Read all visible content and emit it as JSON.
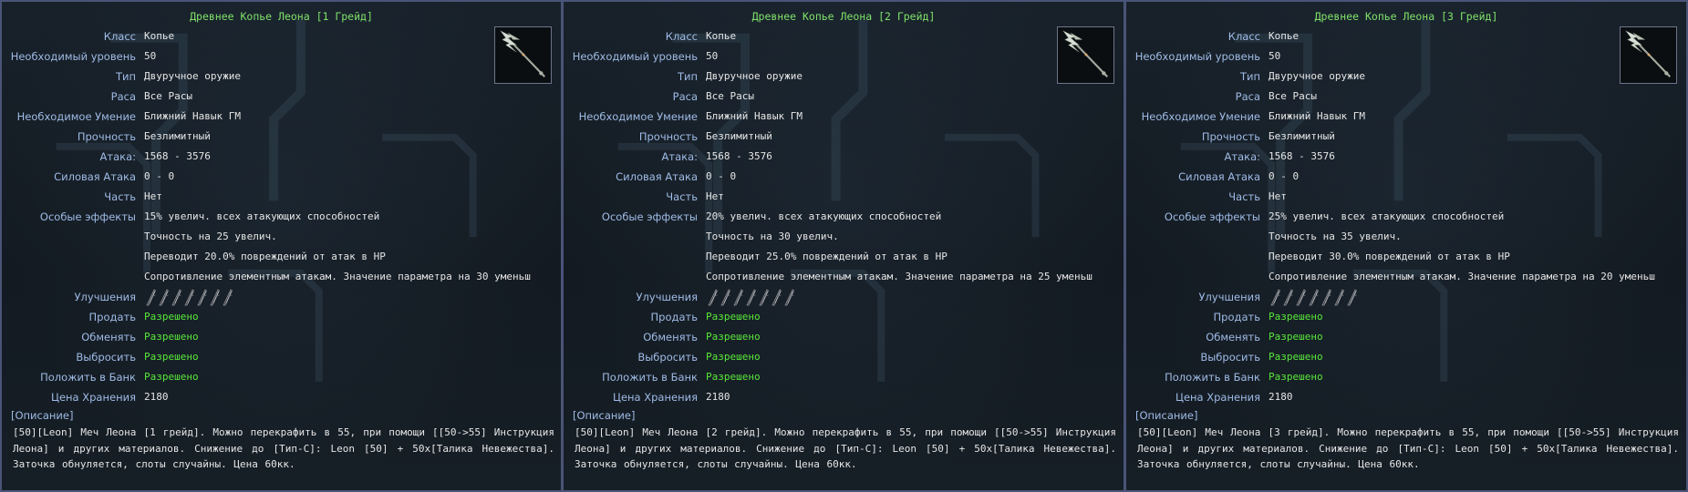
{
  "labels": {
    "class": "Класс",
    "req_level": "Необходимый уровень",
    "type": "Тип",
    "race": "Раса",
    "req_skill": "Необходимое Умение",
    "durability": "Прочность",
    "attack": "Атака:",
    "power_attack": "Силовая Атака",
    "part": "Часть",
    "special": "Особые эффекты",
    "upgrades": "Улучшения",
    "sell": "Продать",
    "trade": "Обменять",
    "drop": "Выбросить",
    "bank": "Положить в Банк",
    "storage_price": "Цена Хранения",
    "description": "[Описание]"
  },
  "icons": {
    "item": "spear-icon",
    "upgrade_slot": "upgrade-slot-icon"
  },
  "colors": {
    "title": "#7fe26a",
    "label": "#9fbbe6",
    "value": "#e6e6e6",
    "allowed": "#59e83a"
  },
  "panels": [
    {
      "title": "Древнее Копье Леона [1 Грейд]",
      "class": "Копье",
      "req_level": "50",
      "type": "Двуручное оружие",
      "race": "Все Расы",
      "req_skill": "Ближний Навык ГМ",
      "durability": "Безлимитный",
      "attack": "1568 - 3576",
      "power_attack": "0 - 0",
      "part": "Нет",
      "special": [
        "15% увелич. всех атакующих способностей",
        "Точность на 25 увелич.",
        "Переводит 20.0% повреждений от атак в HP",
        "Сопротивление элементным атакам. Значение параметра на 30 уменьш"
      ],
      "upgrade_slots": 7,
      "sell": "Разрешено",
      "trade": "Разрешено",
      "drop": "Разрешено",
      "bank": "Разрешено",
      "storage_price": "2180",
      "description": "[50][Leon] Меч Леона [1 грейд]. Можно перекрафить в 55, при помощи [[50->55] Инструкция Леона] и других материалов. Снижение до [Тип-C]: Leon [50] + 50x[Талика Невежества]. Заточка обнуляется, слоты случайны. Цена 60кк."
    },
    {
      "title": "Древнее Копье Леона [2 Грейд]",
      "class": "Копье",
      "req_level": "50",
      "type": "Двуручное оружие",
      "race": "Все Расы",
      "req_skill": "Ближний Навык ГМ",
      "durability": "Безлимитный",
      "attack": "1568 - 3576",
      "power_attack": "0 - 0",
      "part": "Нет",
      "special": [
        "20% увелич. всех атакующих способностей",
        "Точность на 30 увелич.",
        "Переводит 25.0% повреждений от атак в HP",
        "Сопротивление элементным атакам. Значение параметра на 25 уменьш"
      ],
      "upgrade_slots": 7,
      "sell": "Разрешено",
      "trade": "Разрешено",
      "drop": "Разрешено",
      "bank": "Разрешено",
      "storage_price": "2180",
      "description": "[50][Leon] Меч Леона [2 грейд]. Можно перекрафить в 55, при помощи [[50->55] Инструкция Леона] и других материалов. Снижение до [Тип-C]: Leon [50] + 50x[Талика Невежества]. Заточка обнуляется, слоты случайны. Цена 60кк."
    },
    {
      "title": "Древнее Копье Леона [3 Грейд]",
      "class": "Копье",
      "req_level": "50",
      "type": "Двуручное оружие",
      "race": "Все Расы",
      "req_skill": "Ближний Навык ГМ",
      "durability": "Безлимитный",
      "attack": "1568 - 3576",
      "power_attack": "0 - 0",
      "part": "Нет",
      "special": [
        "25% увелич. всех атакующих способностей",
        "Точность на 35 увелич.",
        "Переводит 30.0% повреждений от атак в HP",
        "Сопротивление элементным атакам. Значение параметра на 20 уменьш"
      ],
      "upgrade_slots": 7,
      "sell": "Разрешено",
      "trade": "Разрешено",
      "drop": "Разрешено",
      "bank": "Разрешено",
      "storage_price": "2180",
      "description": "[50][Leon] Меч Леона [3 грейд]. Можно перекрафить в 55, при помощи [[50->55] Инструкция Леона] и других материалов. Снижение до [Тип-C]: Leon [50] + 50x[Талика Невежества]. Заточка обнуляется, слоты случайны. Цена 60кк."
    }
  ]
}
